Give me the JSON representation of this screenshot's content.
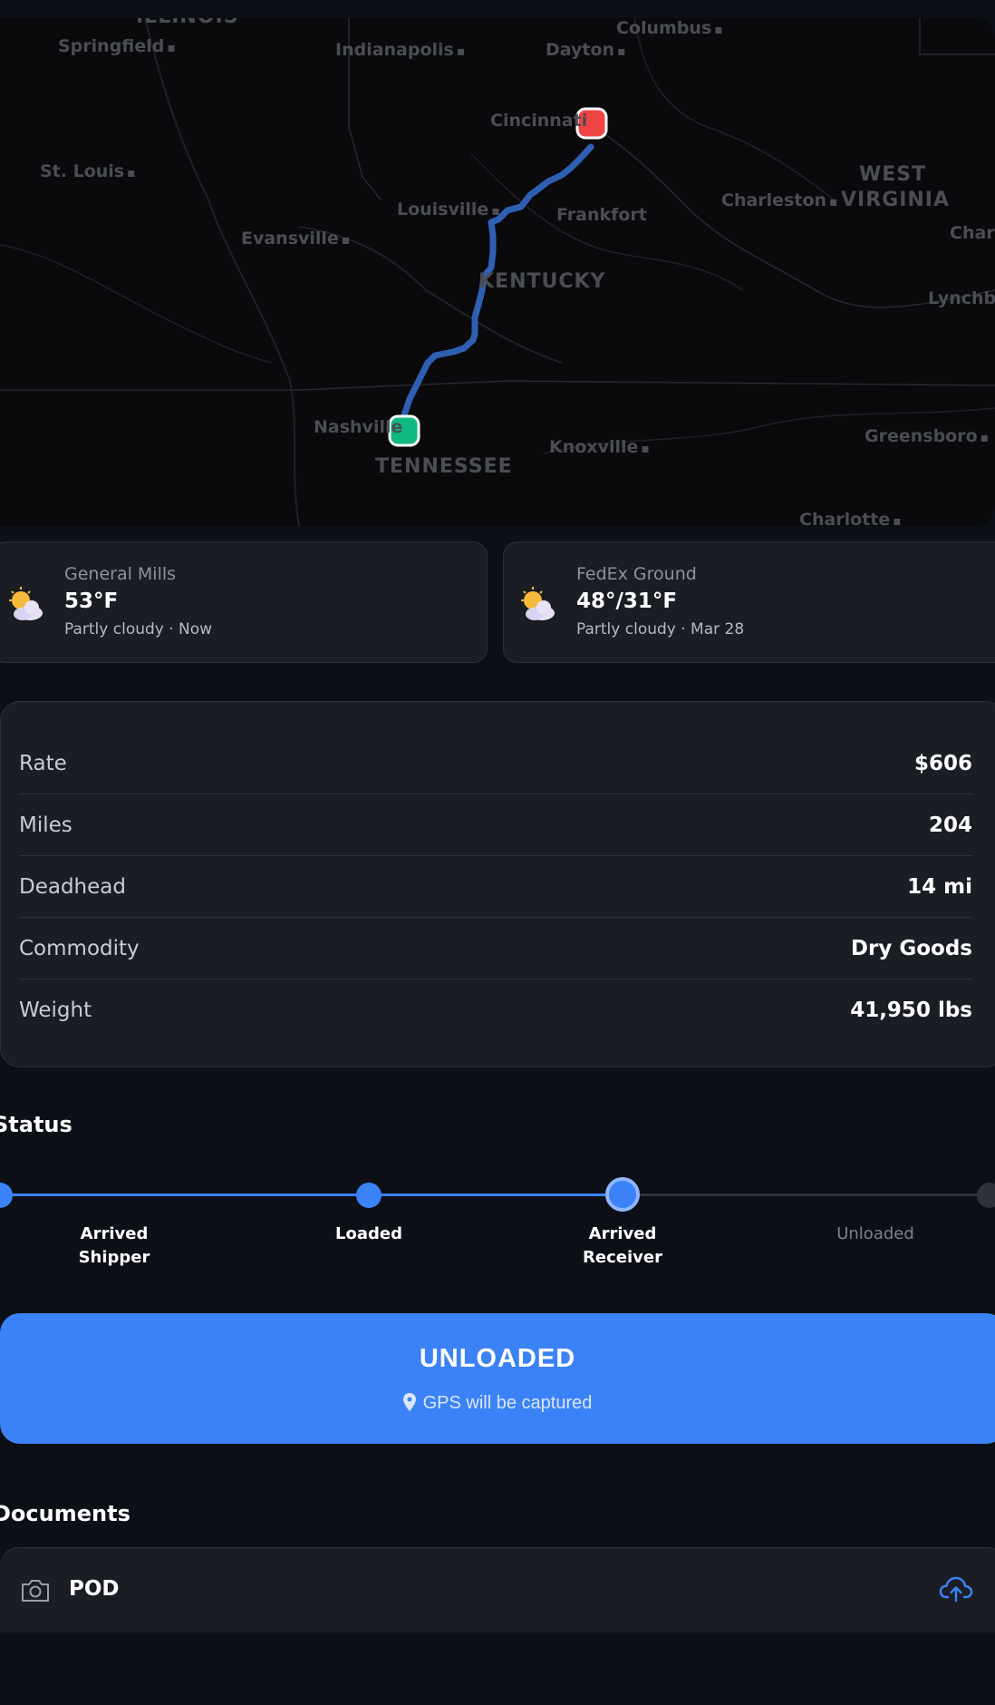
{
  "map": {
    "cities": {
      "springfield": "Springfield",
      "indianapolis": "Indianapolis",
      "dayton": "Dayton",
      "columbus": "Columbus",
      "stlouis": "St. Louis",
      "cincinnati": "Cincinnati",
      "louisville": "Louisville",
      "frankfort": "Frankfort",
      "charleston": "Charleston",
      "evansville": "Evansville",
      "nashville": "Nashville",
      "knoxville": "Knoxville",
      "greensboro": "Greensboro",
      "charlotte": "Charlotte",
      "lynchburg": "Lynchb",
      "charlottesville": "Char"
    },
    "states": {
      "westvirginia_1": "WEST",
      "westvirginia_2": "VIRGINIA",
      "kentucky": "KENTUCKY",
      "tennessee": "TENNESSEE",
      "illinois": "ILLINOIS"
    },
    "colors": {
      "route": "#2f5fb3",
      "origin": "#10b981",
      "destination": "#ef4444"
    }
  },
  "weather": [
    {
      "location": "General Mills",
      "temp": "53°F",
      "desc": "Partly cloudy · Now",
      "icon": "partly-cloudy-icon"
    },
    {
      "location": "FedEx Ground",
      "temp": "48°/31°F",
      "desc": "Partly cloudy · Mar 28",
      "icon": "partly-cloudy-icon"
    }
  ],
  "details": [
    {
      "label": "Rate",
      "value": "$606"
    },
    {
      "label": "Miles",
      "value": "204"
    },
    {
      "label": "Deadhead",
      "value": "14 mi"
    },
    {
      "label": "Commodity",
      "value": "Dry Goods"
    },
    {
      "label": "Weight",
      "value": "41,950 lbs"
    }
  ],
  "status": {
    "title": "Status",
    "steps": [
      {
        "label_1": "Arrived",
        "label_2": "Shipper",
        "state": "done"
      },
      {
        "label_1": "Loaded",
        "label_2": "",
        "state": "done"
      },
      {
        "label_1": "Arrived",
        "label_2": "Receiver",
        "state": "current"
      },
      {
        "label_1": "Unloaded",
        "label_2": "",
        "state": "todo"
      }
    ]
  },
  "action": {
    "title": "UNLOADED",
    "subtitle": "GPS will be captured",
    "color": "#3b82f6"
  },
  "documents": {
    "title": "Documents",
    "items": [
      {
        "label": "POD"
      }
    ]
  }
}
